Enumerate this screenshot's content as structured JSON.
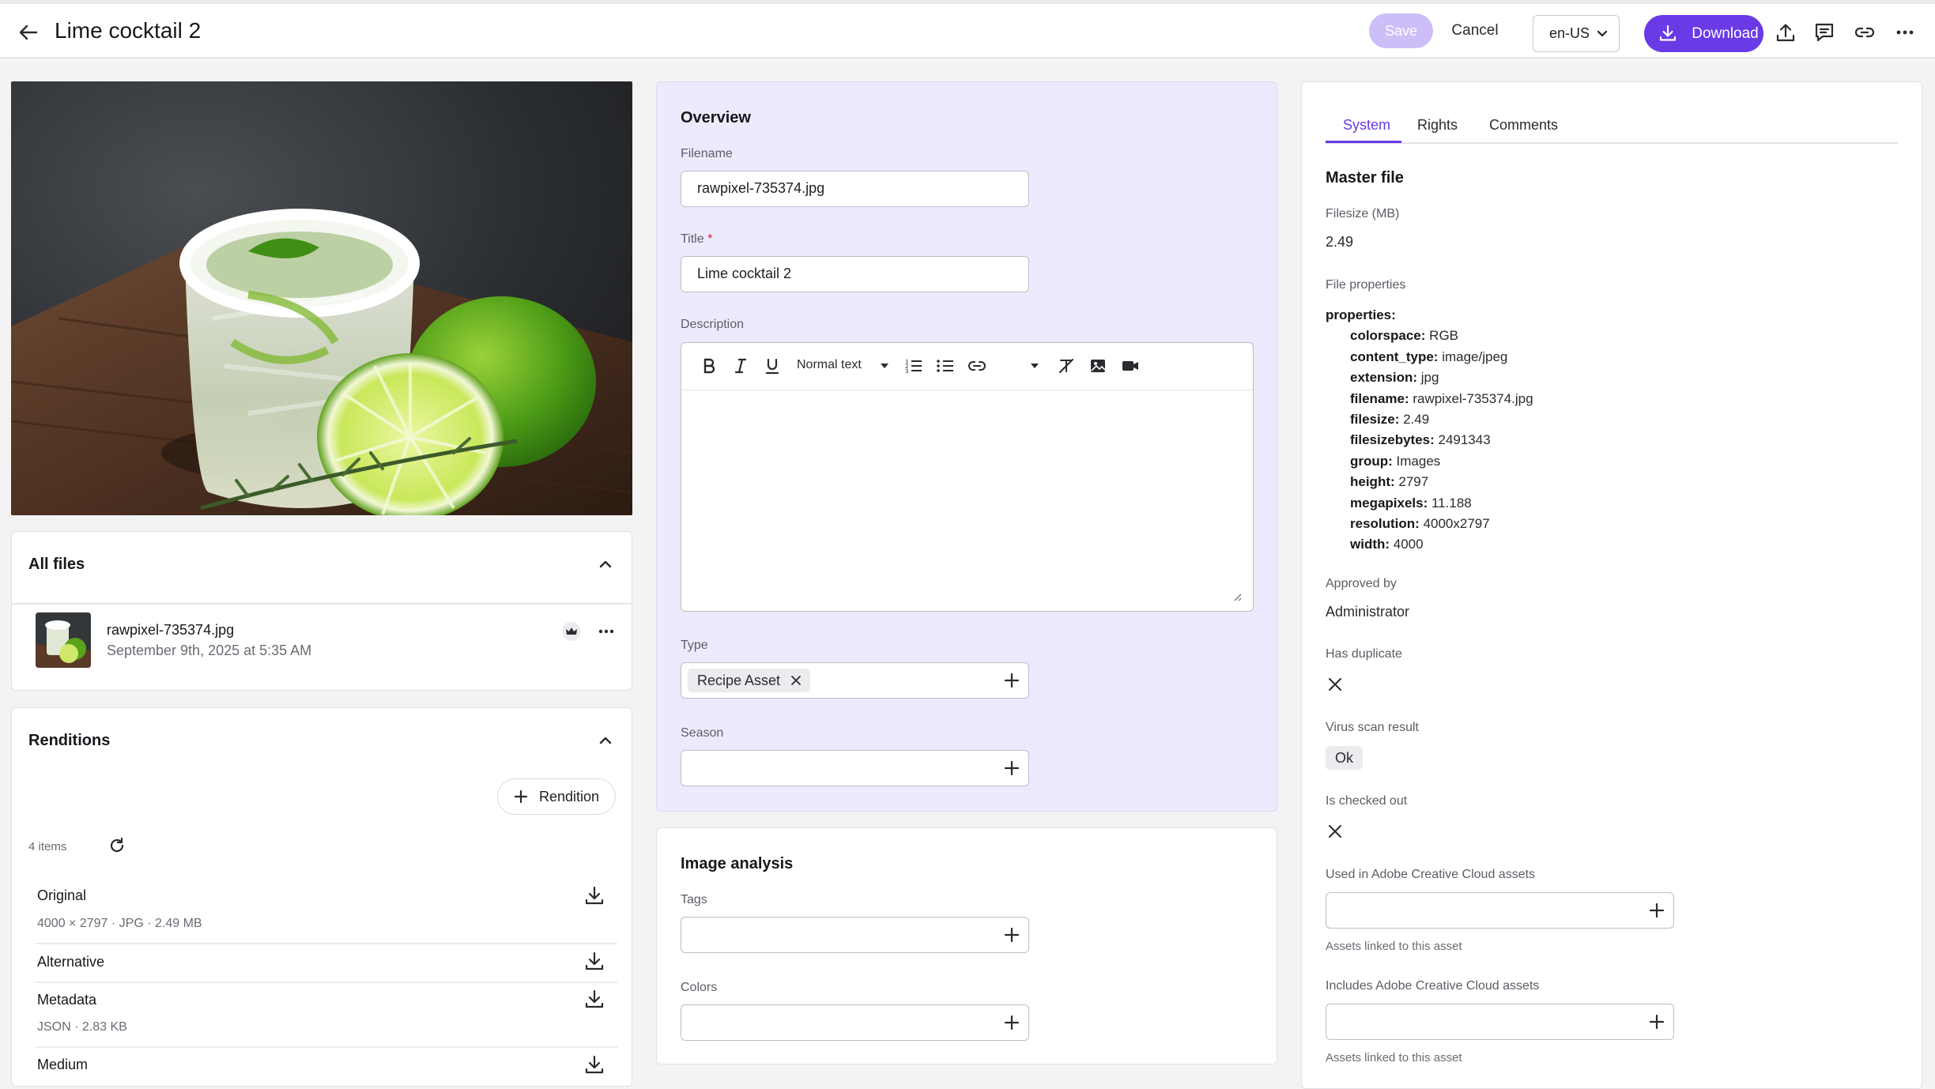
{
  "header": {
    "title": "Lime cocktail 2",
    "save_label": "Save",
    "cancel_label": "Cancel",
    "locale": "en-US",
    "download_label": "Download"
  },
  "all_files": {
    "title": "All files",
    "file_name": "rawpixel-735374.jpg",
    "file_date": "September 9th, 2025 at 5:35 AM"
  },
  "renditions": {
    "title": "Renditions",
    "add_label": "Rendition",
    "count": "4 items",
    "items": [
      {
        "name": "Original",
        "meta": "4000 × 2797 · JPG · 2.49 MB"
      },
      {
        "name": "Alternative",
        "meta": ""
      },
      {
        "name": "Metadata",
        "meta": "JSON · 2.83 KB"
      },
      {
        "name": "Medium",
        "meta": ""
      }
    ]
  },
  "overview": {
    "title": "Overview",
    "filename_label": "Filename",
    "filename_value": "rawpixel-735374.jpg",
    "title_label": "Title",
    "required_mark": "*",
    "title_value": "Lime cocktail 2",
    "description_label": "Description",
    "text_style": "Normal text",
    "type_label": "Type",
    "type_tag": "Recipe Asset",
    "season_label": "Season"
  },
  "image_analysis": {
    "title": "Image analysis",
    "tags_label": "Tags",
    "colors_label": "Colors"
  },
  "side": {
    "tabs": [
      "System",
      "Rights",
      "Comments"
    ],
    "active_tab": "System",
    "master_title": "Master file",
    "filesize_label": "Filesize (MB)",
    "filesize_value": "2.49",
    "props_label": "File properties",
    "props_root": "properties:",
    "props": [
      {
        "k": "colorspace:",
        "v": " RGB"
      },
      {
        "k": "content_type:",
        "v": " image/jpeg"
      },
      {
        "k": "extension:",
        "v": " jpg"
      },
      {
        "k": "filename:",
        "v": " rawpixel-735374.jpg"
      },
      {
        "k": "filesize:",
        "v": " 2.49"
      },
      {
        "k": "filesizebytes:",
        "v": " 2491343"
      },
      {
        "k": "group:",
        "v": " Images"
      },
      {
        "k": "height:",
        "v": " 2797"
      },
      {
        "k": "megapixels:",
        "v": " 11.188"
      },
      {
        "k": "resolution:",
        "v": " 4000x2797"
      },
      {
        "k": "width:",
        "v": " 4000"
      }
    ],
    "approved_label": "Approved by",
    "approved_value": "Administrator",
    "duplicate_label": "Has duplicate",
    "virus_label": "Virus scan result",
    "virus_value": "Ok",
    "checked_label": "Is checked out",
    "used_label": "Used in Adobe Creative Cloud assets",
    "used_hint": "Assets linked to this asset",
    "includes_label": "Includes Adobe Creative Cloud assets",
    "includes_hint": "Assets linked to this asset"
  },
  "colors": {
    "accent": "#6a3ae6",
    "save_disabled": "#cdbef8",
    "overview_bg": "#ecebfd"
  }
}
